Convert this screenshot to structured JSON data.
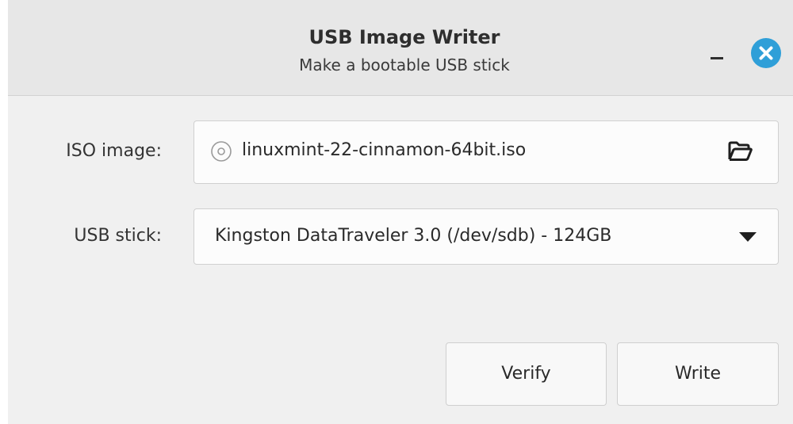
{
  "window": {
    "title": "USB Image Writer",
    "subtitle": "Make a bootable USB stick",
    "controls": {
      "minimize_icon": "minimize-icon",
      "close_icon": "close-icon",
      "close_color": "#2f9fd8"
    }
  },
  "form": {
    "iso": {
      "label": "ISO image:",
      "value": "linuxmint-22-cinnamon-64bit.iso",
      "leading_icon": "disc-icon",
      "trailing_icon": "folder-open-icon"
    },
    "usb": {
      "label": "USB stick:",
      "selected": "Kingston DataTraveler 3.0 (/dev/sdb) - 124GB",
      "trailing_icon": "dropdown-arrow-icon"
    }
  },
  "actions": {
    "verify_label": "Verify",
    "write_label": "Write"
  }
}
